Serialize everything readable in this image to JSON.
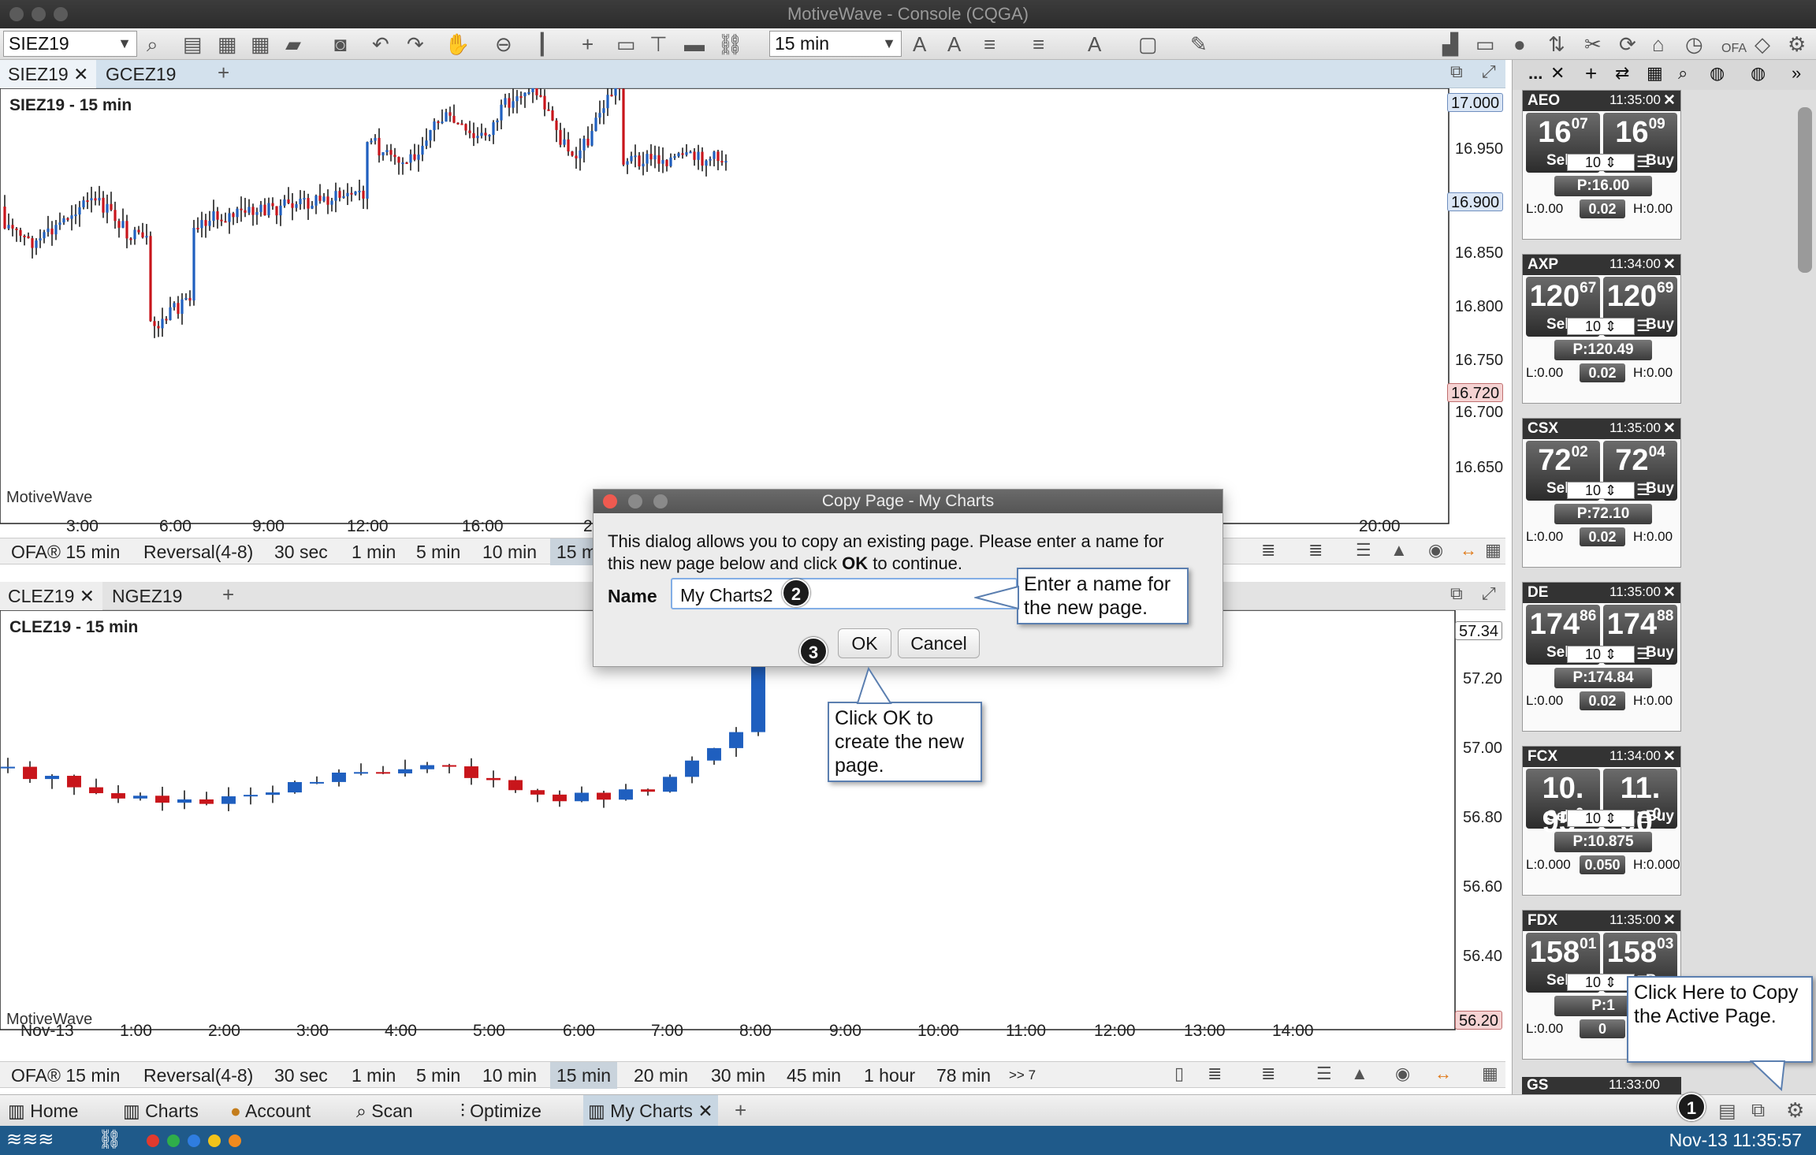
{
  "window": {
    "title": "MotiveWave - Console (CQGA)"
  },
  "toolbar": {
    "symbol": "SIEZ19",
    "timeframe": "15 min",
    "ofa_label": "OFA"
  },
  "top_pane": {
    "tabs": [
      "SIEZ19",
      "GCEZ19"
    ],
    "chart_title": "SIEZ19 - 15 min",
    "watermark": "MotiveWave",
    "y_ticks": [
      "16.950",
      "16.900",
      "16.850",
      "16.800",
      "16.750",
      "16.700",
      "16.650"
    ],
    "price_tags": {
      "top": "17.000",
      "current": "16.900",
      "low": "16.720"
    },
    "x_ticks": [
      "3:00",
      "6:00",
      "9:00",
      "12:00",
      "16:00",
      "20:0",
      "20:00"
    ],
    "bar_sizes": [
      "OFA® 15 min",
      "Reversal(4-8)",
      "30 sec",
      "1 min",
      "5 min",
      "10 min",
      "15 m"
    ]
  },
  "bottom_pane": {
    "tabs": [
      "CLEZ19",
      "NGEZ19"
    ],
    "chart_title": "CLEZ19 - 15 min",
    "watermark": "MotiveWave",
    "y_ticks": [
      "57.20",
      "57.00",
      "56.80",
      "56.60",
      "56.40"
    ],
    "price_tags": {
      "top": "57.34",
      "low": "56.20"
    },
    "x_ticks": [
      "Nov-13",
      "1:00",
      "2:00",
      "3:00",
      "4:00",
      "5:00",
      "6:00",
      "7:00",
      "8:00",
      "9:00",
      "10:00",
      "11:00",
      "12:00",
      "13:00",
      "14:00"
    ],
    "bar_sizes": [
      "OFA® 15 min",
      "Reversal(4-8)",
      "30 sec",
      "1 min",
      "5 min",
      "10 min",
      "15 min",
      "20 min",
      "30 min",
      "45 min",
      "1 hour",
      "78 min",
      ">> 7"
    ]
  },
  "dialog": {
    "title": "Copy Page - My Charts",
    "desc_line1": "This dialog allows you to copy an existing page.  Please enter a name for",
    "desc_line2_pre": "this new page below and click ",
    "desc_line2_bold": "OK",
    "desc_line2_post": " to continue.",
    "name_label": "Name",
    "name_value": "My Charts2",
    "ok": "OK",
    "cancel": "Cancel"
  },
  "callouts": {
    "name_hint": [
      "Enter a name for",
      "the new page."
    ],
    "ok_hint": [
      "Click OK to",
      "create the new",
      "page."
    ],
    "copy_hint": [
      "Click Here to Copy",
      "the Active Page."
    ]
  },
  "badges": [
    "1",
    "2",
    "3"
  ],
  "right_panel": {
    "toolbar_label": "...",
    "cards": [
      {
        "symbol": "AEO",
        "time": "11:35:00",
        "sell_main": "16",
        "sell_frac": "07",
        "buy_main": "16",
        "buy_frac": "09",
        "qty": "10",
        "price": "P:16.00",
        "low": "L:0.00",
        "spread": "0.02",
        "high": "H:0.00"
      },
      {
        "symbol": "AXP",
        "time": "11:34:00",
        "sell_main": "120",
        "sell_frac": "67",
        "buy_main": "120",
        "buy_frac": "69",
        "qty": "10",
        "price": "P:120.49",
        "low": "L:0.00",
        "spread": "0.02",
        "high": "H:0.00"
      },
      {
        "symbol": "CSX",
        "time": "11:35:00",
        "sell_main": "72",
        "sell_frac": "02",
        "buy_main": "72",
        "buy_frac": "04",
        "qty": "10",
        "price": "P:72.10",
        "low": "L:0.00",
        "spread": "0.02",
        "high": "H:0.00"
      },
      {
        "symbol": "DE",
        "time": "11:35:00",
        "sell_main": "174",
        "sell_frac": "86",
        "buy_main": "174",
        "buy_frac": "88",
        "qty": "10",
        "price": "P:174.84",
        "low": "L:0.00",
        "spread": "0.02",
        "high": "H:0.00"
      },
      {
        "symbol": "FCX",
        "time": "11:34:00",
        "sell_main": "10. 95",
        "sell_frac": "0",
        "buy_main": "11. 00",
        "buy_frac": "0",
        "qty": "10",
        "price": "P:10.875",
        "low": "L:0.000",
        "spread": "0.050",
        "high": "H:0.000"
      },
      {
        "symbol": "FDX",
        "time": "11:35:00",
        "sell_main": "158",
        "sell_frac": "01",
        "buy_main": "158",
        "buy_frac": "03",
        "qty": "10",
        "price": "P:1",
        "low": "L:0.00",
        "spread": "0",
        "high": ""
      }
    ],
    "sell_label": "Sell",
    "buy_label": "Buy",
    "partial_card": {
      "symbol": "GS",
      "time": "11:33:00"
    }
  },
  "nav": {
    "items": [
      "Home",
      "Charts",
      "Account",
      "Scan",
      "Optimize",
      "My Charts"
    ]
  },
  "status": {
    "datetime": "Nov-13 11:35:57",
    "dots": [
      "#e23a2e",
      "#2fae4a",
      "#2f7de0",
      "#f2c31a",
      "#f08a1e"
    ]
  },
  "colors": {
    "up": "#1f5fbf",
    "down": "#c8151b",
    "tab_strip": "#d3e1ed",
    "status": "#1f5a8a"
  }
}
